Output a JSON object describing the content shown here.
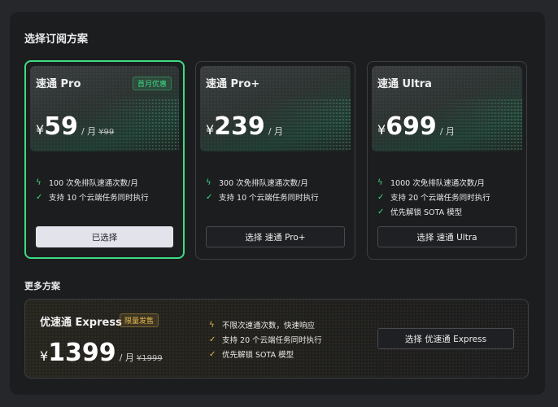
{
  "page": {
    "title": "选择订阅方案",
    "more_title": "更多方案"
  },
  "plans": [
    {
      "name": "速通 Pro",
      "badge": "首月优惠",
      "currency": "¥",
      "price": "59",
      "period": "/ 月",
      "original_price": "¥99",
      "features": [
        {
          "icon": "lightning-icon",
          "text": "100 次免排队速通次数/月"
        },
        {
          "icon": "check-icon",
          "text": "支持 10 个云端任务同时执行"
        }
      ],
      "button_label": "已选择",
      "selected": true
    },
    {
      "name": "速通 Pro+",
      "currency": "¥",
      "price": "239",
      "period": "/ 月",
      "features": [
        {
          "icon": "lightning-icon",
          "text": "300 次免排队速通次数/月"
        },
        {
          "icon": "check-icon",
          "text": "支持 10 个云端任务同时执行"
        }
      ],
      "button_label": "选择 速通 Pro+",
      "selected": false
    },
    {
      "name": "速通 Ultra",
      "currency": "¥",
      "price": "699",
      "period": "/ 月",
      "features": [
        {
          "icon": "lightning-icon",
          "text": "1000 次免排队速通次数/月"
        },
        {
          "icon": "check-icon",
          "text": "支持 20 个云端任务同时执行"
        },
        {
          "icon": "check-icon",
          "text": "优先解锁 SOTA 模型"
        }
      ],
      "button_label": "选择 速通 Ultra",
      "selected": false
    }
  ],
  "express": {
    "name": "优速通 Express",
    "badge": "限量发售",
    "currency": "¥",
    "price": "1399",
    "period": "/ 月",
    "original_price": "¥1999",
    "features": [
      {
        "icon": "lightning-icon",
        "text": "不限次速通次数，快速响应"
      },
      {
        "icon": "check-icon",
        "text": "支持 20 个云端任务同时执行"
      },
      {
        "icon": "check-icon",
        "text": "优先解锁 SOTA 模型"
      }
    ],
    "button_label": "选择 优速通 Express"
  },
  "colors": {
    "accent": "#3ddc84",
    "gold": "#e6b84a",
    "panel": "#1c1d1f",
    "background": "#26272a"
  }
}
